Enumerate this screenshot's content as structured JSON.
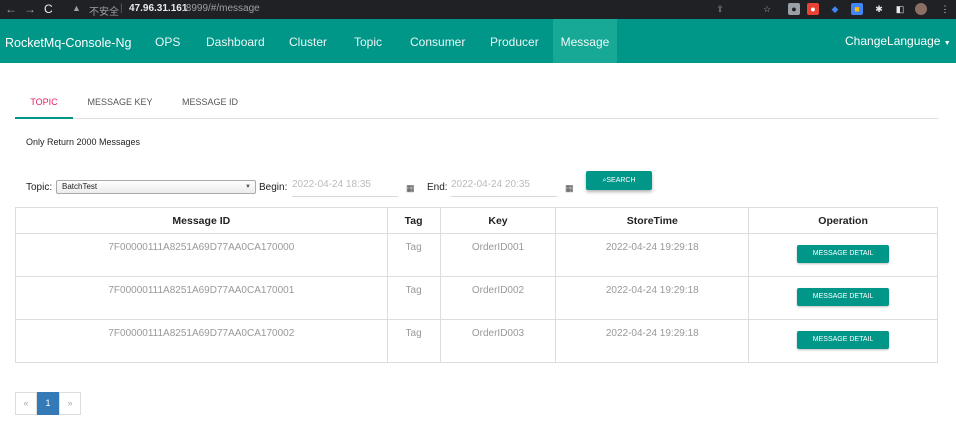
{
  "browser": {
    "back": "←",
    "forward": "→",
    "reload": "C",
    "insecure_label": "不安全",
    "host": "47.96.31.161",
    "path": ":8999/#/message"
  },
  "navbar": {
    "brand": "RocketMq-Console-Ng",
    "items": [
      "OPS",
      "Dashboard",
      "Cluster",
      "Topic",
      "Consumer",
      "Producer",
      "Message"
    ],
    "active": "Message",
    "language": "ChangeLanguage"
  },
  "tabs": [
    "TOPIC",
    "MESSAGE KEY",
    "MESSAGE ID"
  ],
  "active_tab": "TOPIC",
  "limit_text": "Only Return 2000 Messages",
  "form": {
    "topic_label": "Topic:",
    "topic_value": "BatchTest",
    "begin_label": "Begin:",
    "begin_value": "2022-04-24 18:35",
    "end_label": "End:",
    "end_value": "2022-04-24 20:35",
    "search_label": "SEARCH"
  },
  "table": {
    "headers": [
      "Message ID",
      "Tag",
      "Key",
      "StoreTime",
      "Operation"
    ],
    "rows": [
      {
        "id": "7F00000111A8251A69D77AA0CA170000",
        "tag": "Tag",
        "key": "OrderID001",
        "time": "2022-04-24 19:29:18",
        "action": "MESSAGE DETAIL"
      },
      {
        "id": "7F00000111A8251A69D77AA0CA170001",
        "tag": "Tag",
        "key": "OrderID002",
        "time": "2022-04-24 19:29:18",
        "action": "MESSAGE DETAIL"
      },
      {
        "id": "7F00000111A8251A69D77AA0CA170002",
        "tag": "Tag",
        "key": "OrderID003",
        "time": "2022-04-24 19:29:18",
        "action": "MESSAGE DETAIL"
      }
    ]
  },
  "pagination": {
    "prev": "«",
    "current": "1",
    "next": "»"
  },
  "colors": {
    "primary": "#009688",
    "active_tab": "#e91e63",
    "page_active": "#337ab7"
  }
}
